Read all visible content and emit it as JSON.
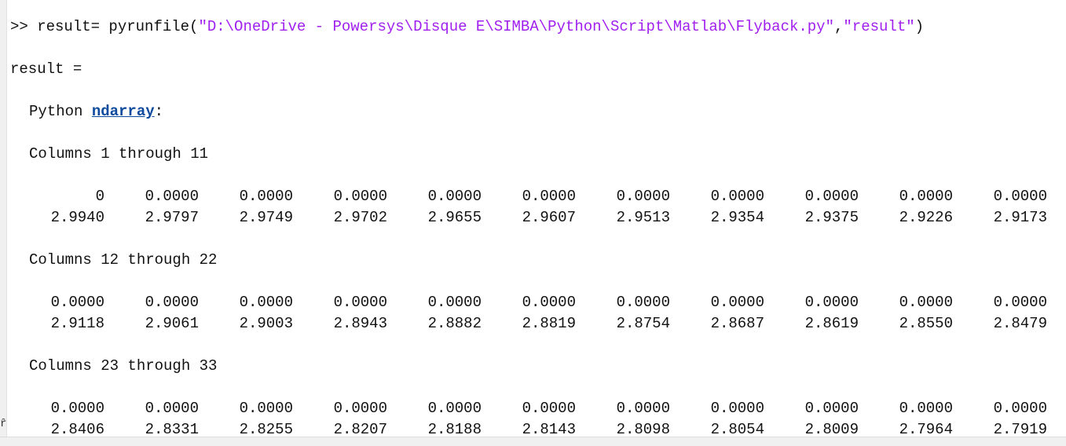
{
  "command": {
    "prompt": ">>",
    "pre": " result= pyrunfile(",
    "str1": "\"D:\\OneDrive - Powersys\\Disque E\\SIMBA\\Python\\Script\\Matlab\\Flyback.py\"",
    "comma": ",",
    "str2": "\"result\"",
    "post": ")"
  },
  "result_label": "result =",
  "type_prefix": "Python ",
  "type_link": "ndarray",
  "type_suffix": ":",
  "blocks": [
    {
      "header": "Columns 1 through 11",
      "rows": [
        [
          "0",
          "0.0000",
          "0.0000",
          "0.0000",
          "0.0000",
          "0.0000",
          "0.0000",
          "0.0000",
          "0.0000",
          "0.0000",
          "0.0000"
        ],
        [
          "2.9940",
          "2.9797",
          "2.9749",
          "2.9702",
          "2.9655",
          "2.9607",
          "2.9513",
          "2.9354",
          "2.9375",
          "2.9226",
          "2.9173"
        ]
      ]
    },
    {
      "header": "Columns 12 through 22",
      "rows": [
        [
          "0.0000",
          "0.0000",
          "0.0000",
          "0.0000",
          "0.0000",
          "0.0000",
          "0.0000",
          "0.0000",
          "0.0000",
          "0.0000",
          "0.0000"
        ],
        [
          "2.9118",
          "2.9061",
          "2.9003",
          "2.8943",
          "2.8882",
          "2.8819",
          "2.8754",
          "2.8687",
          "2.8619",
          "2.8550",
          "2.8479"
        ]
      ]
    },
    {
      "header": "Columns 23 through 33",
      "rows": [
        [
          "0.0000",
          "0.0000",
          "0.0000",
          "0.0000",
          "0.0000",
          "0.0000",
          "0.0000",
          "0.0000",
          "0.0000",
          "0.0000",
          "0.0000"
        ],
        [
          "2.8406",
          "2.8331",
          "2.8255",
          "2.8207",
          "2.8188",
          "2.8143",
          "2.8098",
          "2.8054",
          "2.8009",
          "2.7964",
          "2.7919"
        ]
      ]
    }
  ]
}
